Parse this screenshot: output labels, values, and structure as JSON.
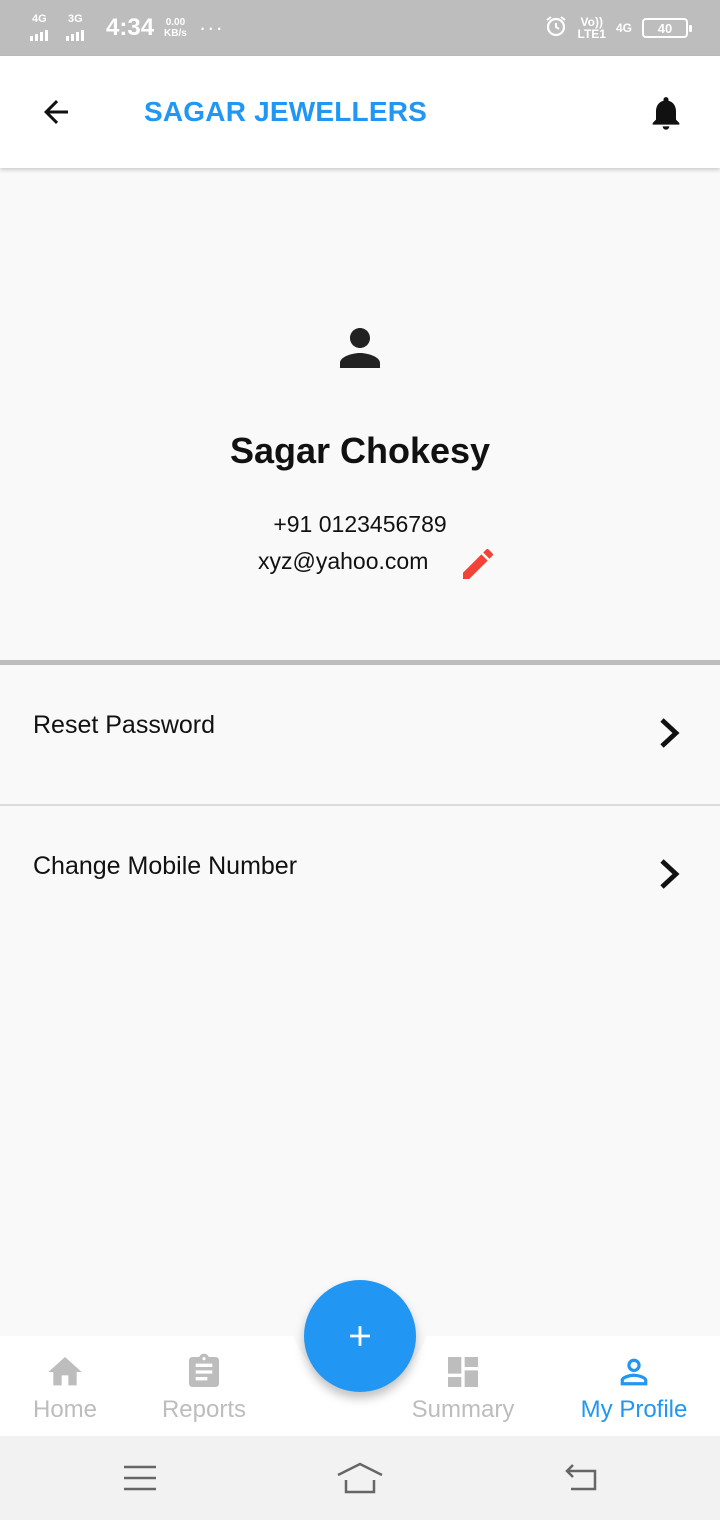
{
  "status_bar": {
    "sim1_type": "4G",
    "sim2_type": "3G",
    "time": "4:34",
    "speed_value": "0.00",
    "speed_unit": "KB/s",
    "more": "···",
    "volte_line1": "Vo))",
    "volte_line2": "LTE1",
    "network_4g": "4G",
    "battery": "40"
  },
  "app_bar": {
    "title": "SAGAR JEWELLERS"
  },
  "profile": {
    "name": "Sagar Chokesy",
    "phone": "+91 0123456789",
    "email": "xyz@yahoo.com"
  },
  "menu": [
    {
      "label": "Reset Password"
    },
    {
      "label": "Change Mobile Number"
    }
  ],
  "bottom_nav": [
    {
      "label": "Home",
      "icon": "home-icon",
      "active": false
    },
    {
      "label": "Reports",
      "icon": "clipboard-icon",
      "active": false
    },
    {
      "label": "Summary",
      "icon": "dashboard-icon",
      "active": false
    },
    {
      "label": "My Profile",
      "icon": "person-icon",
      "active": true
    }
  ],
  "fab": {
    "icon": "plus-icon"
  },
  "colors": {
    "accent": "#2196f3",
    "edit_icon": "#f44336",
    "inactive": "#bdbdbd",
    "status_bar": "#bdbdbd"
  }
}
